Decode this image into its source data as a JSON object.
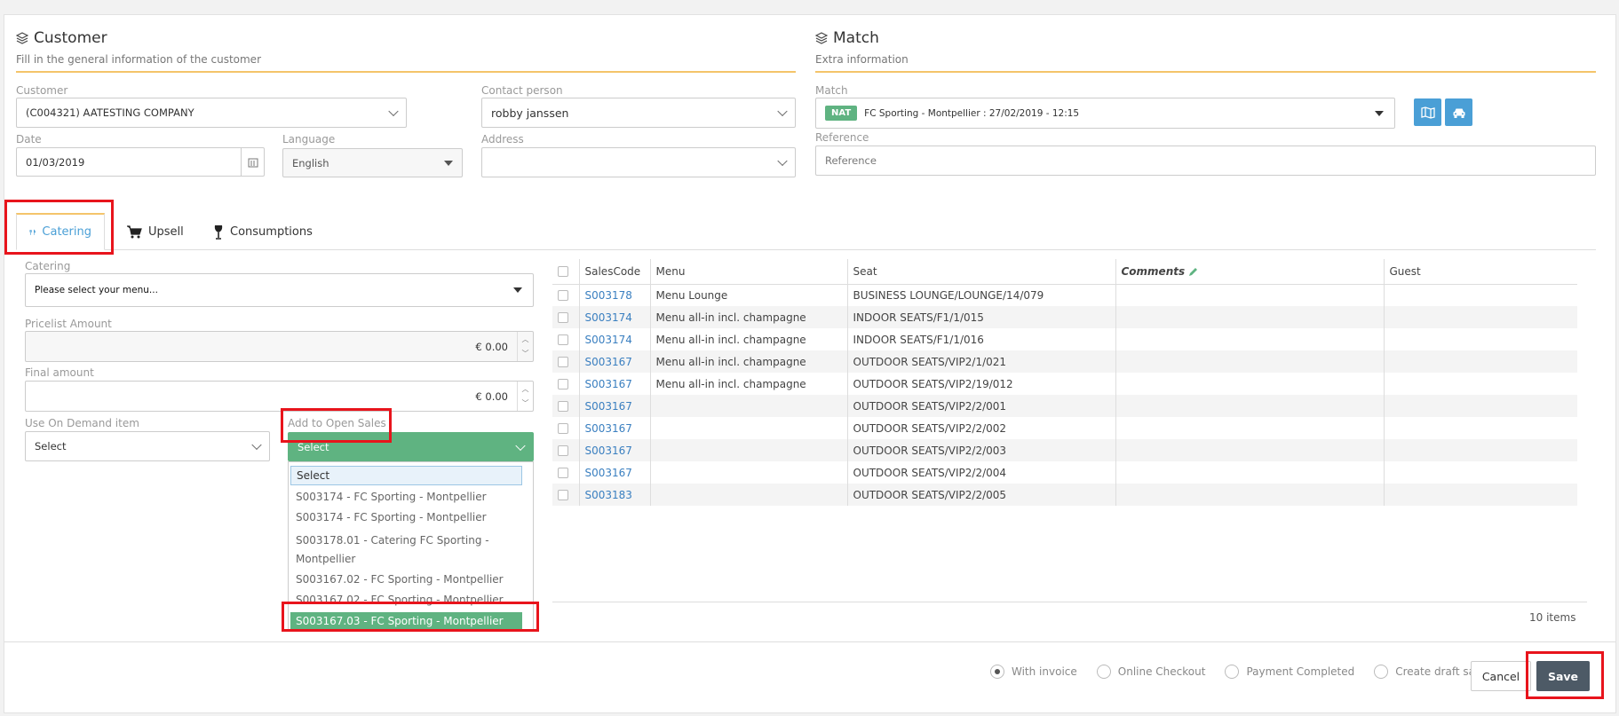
{
  "customer_section": {
    "title": "Customer",
    "subtitle": "Fill in the general information of the customer",
    "customer_label": "Customer",
    "customer_value": "(C004321) AATESTING COMPANY",
    "contact_label": "Contact person",
    "contact_value": "robby janssen",
    "date_label": "Date",
    "date_value": "01/03/2019",
    "language_label": "Language",
    "language_value": "English",
    "address_label": "Address",
    "address_value": ""
  },
  "match_section": {
    "title": "Match",
    "subtitle": "Extra information",
    "match_label": "Match",
    "match_badge": "NAT",
    "match_value": "FC Sporting - Montpellier : 27/02/2019 - 12:15",
    "reference_label": "Reference",
    "reference_placeholder": "Reference"
  },
  "tabs": [
    {
      "label": "Catering",
      "active": true
    },
    {
      "label": "Upsell",
      "active": false
    },
    {
      "label": "Consumptions",
      "active": false
    }
  ],
  "catering_form": {
    "catering_label": "Catering",
    "catering_value": "Please select your menu...",
    "pricelist_label": "Pricelist Amount",
    "pricelist_value": "€ 0.00",
    "final_label": "Final amount",
    "final_value": "€ 0.00",
    "on_demand_label": "Use On Demand item",
    "on_demand_value": "Select",
    "open_sales_label": "Add to Open Sales",
    "open_sales_value": "Select",
    "open_sales_options": [
      "Select",
      "S003174 - FC Sporting - Montpellier",
      "S003174 - FC Sporting - Montpellier",
      "S003178.01 - Catering FC Sporting - Montpellier",
      "S003167.02 - FC Sporting - Montpellier",
      "S003167.02 - FC Sporting - Montpellier",
      "S003167.03 - FC Sporting - Montpellier"
    ],
    "open_sales_highlighted_index": 6
  },
  "grid": {
    "columns": [
      "SalesCode",
      "Menu",
      "Seat",
      "Comments",
      "Guest"
    ],
    "rows": [
      {
        "code": "S003178",
        "menu": "Menu Lounge",
        "seat": "BUSINESS LOUNGE/LOUNGE/14/079"
      },
      {
        "code": "S003174",
        "menu": "Menu all-in incl. champagne",
        "seat": "INDOOR SEATS/F1/1/015"
      },
      {
        "code": "S003174",
        "menu": "Menu all-in incl. champagne",
        "seat": "INDOOR SEATS/F1/1/016"
      },
      {
        "code": "S003167",
        "menu": "Menu all-in incl. champagne",
        "seat": "OUTDOOR SEATS/VIP2/1/021"
      },
      {
        "code": "S003167",
        "menu": "Menu all-in incl. champagne",
        "seat": "OUTDOOR SEATS/VIP2/19/012"
      },
      {
        "code": "S003167",
        "menu": "",
        "seat": "OUTDOOR SEATS/VIP2/2/001"
      },
      {
        "code": "S003167",
        "menu": "",
        "seat": "OUTDOOR SEATS/VIP2/2/002"
      },
      {
        "code": "S003167",
        "menu": "",
        "seat": "OUTDOOR SEATS/VIP2/2/003"
      },
      {
        "code": "S003167",
        "menu": "",
        "seat": "OUTDOOR SEATS/VIP2/2/004"
      },
      {
        "code": "S003183",
        "menu": "",
        "seat": "OUTDOOR SEATS/VIP2/2/005"
      }
    ],
    "items_count": "10 items"
  },
  "footer": {
    "options": [
      {
        "label": "With invoice",
        "selected": true
      },
      {
        "label": "Online Checkout",
        "selected": false
      },
      {
        "label": "Payment Completed",
        "selected": false
      },
      {
        "label": "Create draft sales",
        "selected": false
      }
    ],
    "cancel_label": "Cancel",
    "save_label": "Save"
  },
  "colors": {
    "accent_blue": "#4a9fd6",
    "accent_green": "#5fb381",
    "rule_orange": "#f4c46a",
    "highlight_red": "#e8141c",
    "save_dark": "#4d5a66"
  }
}
